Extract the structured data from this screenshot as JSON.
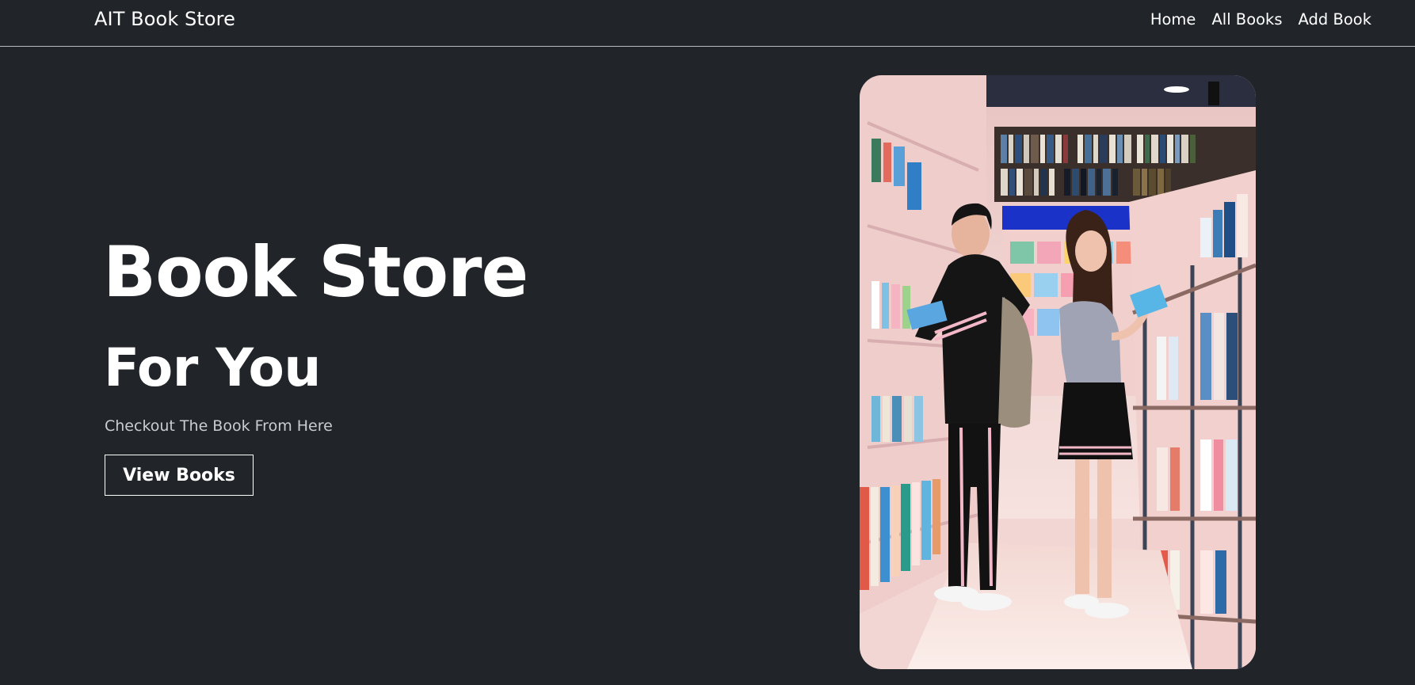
{
  "navbar": {
    "brand": "AIT Book Store",
    "links": [
      {
        "label": "Home"
      },
      {
        "label": "All Books"
      },
      {
        "label": "Add Book"
      }
    ]
  },
  "hero": {
    "title": "Book Store",
    "subtitle": "For You",
    "text": "Checkout The Book From Here",
    "button_label": "View Books"
  },
  "image": {
    "subject": "two people reading books between shelves in a bookstore"
  },
  "colors": {
    "background": "#212529",
    "text": "#ffffff",
    "muted_text": "#c9ccd0",
    "divider": "#b9bcc0"
  }
}
